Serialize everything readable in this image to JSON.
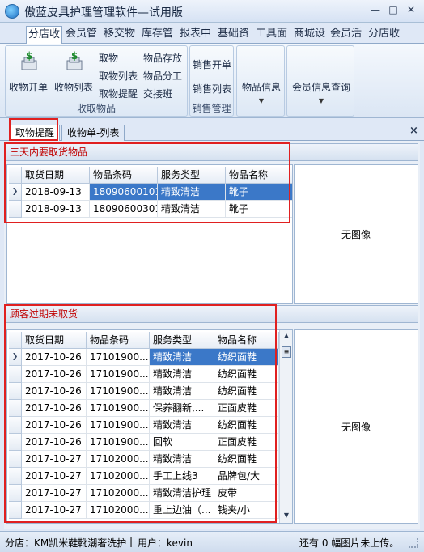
{
  "window": {
    "title": "傲蓝皮具护理管理软件—试用版",
    "min": "—",
    "max": "□",
    "close": "✕"
  },
  "main_tabs": [
    {
      "label": "分店收",
      "active": true
    },
    {
      "label": "会员管"
    },
    {
      "label": "移交物"
    },
    {
      "label": "库存管"
    },
    {
      "label": "报表中"
    },
    {
      "label": "基础资"
    },
    {
      "label": "工具面"
    },
    {
      "label": "商城设"
    },
    {
      "label": "会员活"
    },
    {
      "label": "分店收"
    }
  ],
  "ribbon": {
    "groups": [
      {
        "label": "收取物品"
      },
      {
        "label": "销售管理"
      },
      {
        "label": ""
      },
      {
        "label": ""
      }
    ],
    "receive": {
      "open_label": "收物开单",
      "list_label": "收物列表",
      "take_label": "取物",
      "take_list_label": "取物列表",
      "take_remind_label": "取物提醒",
      "storage_label": "物品存放",
      "assign_label": "物品分工",
      "handover_label": "交接班"
    },
    "sales": {
      "open_label": "销售开单",
      "list_label": "销售列表"
    },
    "item_info_label": "物品信息",
    "member_query_label": "会员信息查询"
  },
  "sub_tabs": [
    {
      "label": "取物提醒",
      "active": true
    },
    {
      "label": "收物单-列表"
    }
  ],
  "close_panel": "×",
  "panel1": {
    "title": "三天内要取货物品",
    "columns": [
      "取货日期",
      "物品条码",
      "服务类型",
      "物品名称"
    ],
    "rows": [
      [
        "2018-09-13",
        "18090600101",
        "精致清洁",
        "靴子"
      ],
      [
        "2018-09-13",
        "18090600301",
        "精致清洁",
        "靴子"
      ]
    ],
    "image_placeholder": "无图像"
  },
  "panel2": {
    "title": "顾客过期未取货",
    "columns": [
      "取货日期",
      "物品条码",
      "服务类型",
      "物品名称"
    ],
    "rows": [
      [
        "2017-10-26",
        "17101900...",
        "精致清洁",
        "纺织面鞋"
      ],
      [
        "2017-10-26",
        "17101900...",
        "精致清洁",
        "纺织面鞋"
      ],
      [
        "2017-10-26",
        "17101900...",
        "精致清洁",
        "纺织面鞋"
      ],
      [
        "2017-10-26",
        "17101900...",
        "保养翻新,...",
        "正面皮鞋"
      ],
      [
        "2017-10-26",
        "17101900...",
        "精致清洁",
        "纺织面鞋"
      ],
      [
        "2017-10-26",
        "17101900...",
        "回软",
        "正面皮鞋"
      ],
      [
        "2017-10-27",
        "17102000...",
        "精致清洁",
        "纺织面鞋"
      ],
      [
        "2017-10-27",
        "17102000...",
        "手工上线3",
        "品牌包/大"
      ],
      [
        "2017-10-27",
        "17102000...",
        "精致清洁护理",
        "皮带"
      ],
      [
        "2017-10-27",
        "17102000...",
        "重上边油（...",
        "钱夹/小"
      ]
    ],
    "image_placeholder": "无图像"
  },
  "status": {
    "store": "分店：KM凯米鞋靴潮奢洗护",
    "user": "用户：kevin",
    "pending": "还有 0 幅图片未上传。"
  }
}
